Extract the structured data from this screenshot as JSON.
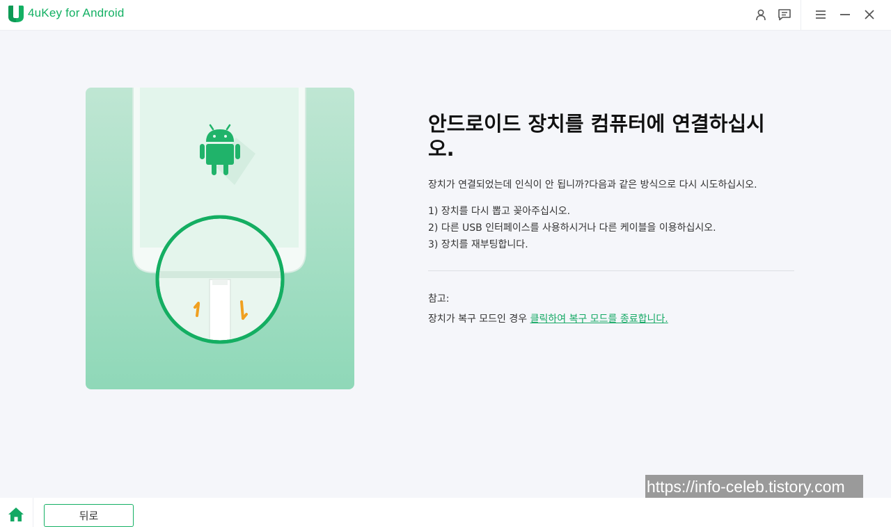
{
  "app": {
    "title": "4uKey for Android"
  },
  "titlebar": {
    "icons": [
      "user-icon",
      "feedback-icon",
      "menu-icon",
      "minimize-icon",
      "close-icon"
    ]
  },
  "main": {
    "heading": "안드로이드 장치를 컴퓨터에 연결하십시오.",
    "subtext": "장치가 연결되었는데 인식이 안 됩니까?다음과 같은 방식으로 다시 시도하십시오.",
    "steps": [
      "1) 장치를 다시 뽑고 꽂아주십시오.",
      "2) 다른 USB 인터페이스를 사용하시거나 다른 케이블을 이용하십시오.",
      "3) 장치를 재부팅합니다."
    ],
    "note_label": "참고:",
    "note_text": "장치가 복구 모드인 경우 ",
    "note_link": "클릭하여 복구 모드를 종료합니다."
  },
  "footer": {
    "back_label": "뒤로"
  },
  "watermark": "https://info-celeb.tistory.com",
  "colors": {
    "brand": "#13b063",
    "link": "#13a863",
    "illustration_bg": "#a8dfc6"
  }
}
